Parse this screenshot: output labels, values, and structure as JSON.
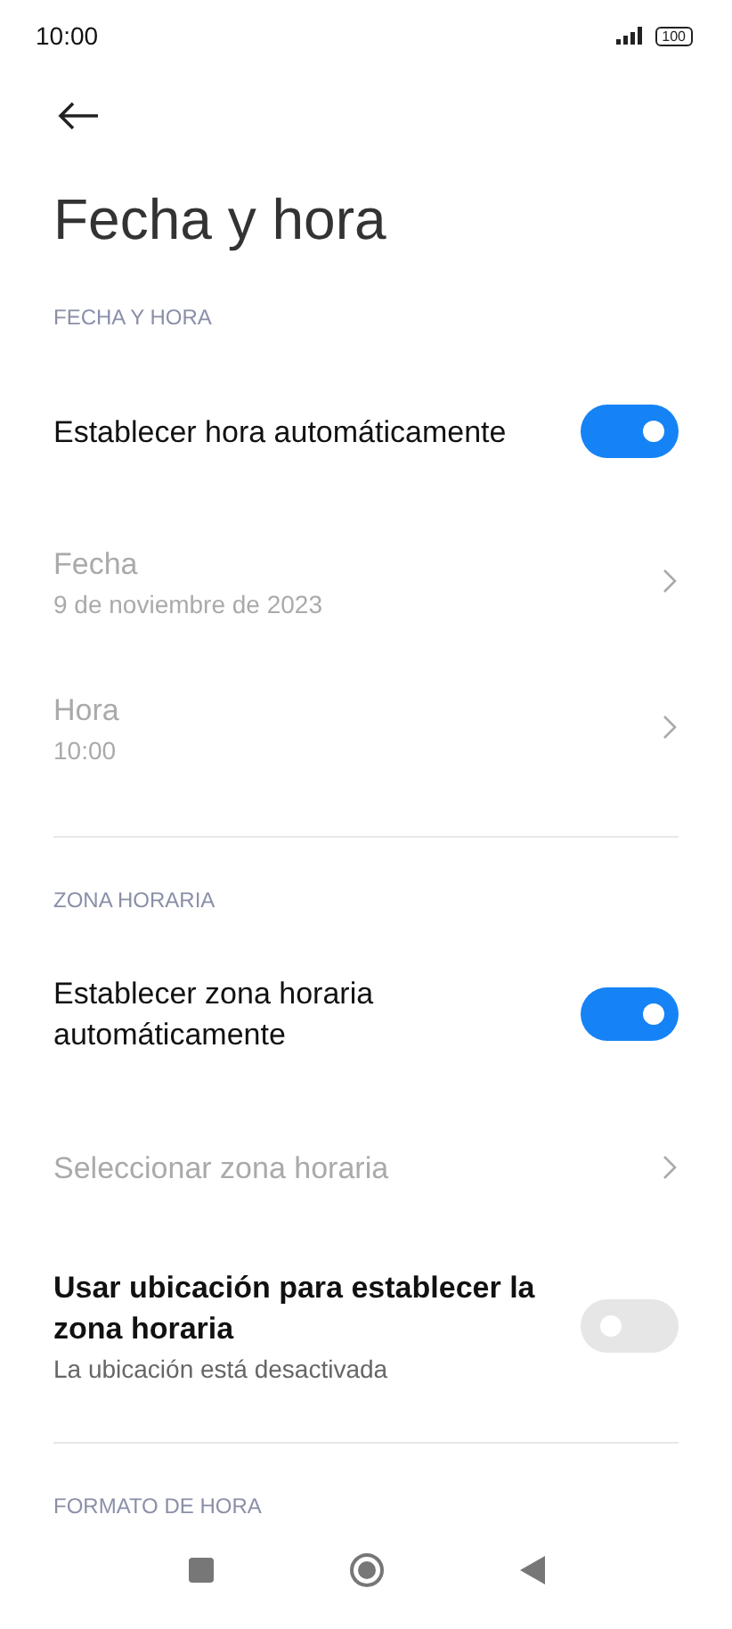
{
  "status_bar": {
    "time": "10:00",
    "battery": "100"
  },
  "title": "Fecha y hora",
  "sections": [
    {
      "kind": "header",
      "label": "FECHA Y HORA"
    },
    {
      "kind": "toggle",
      "title": "Establecer hora automáticamente",
      "on": true
    },
    {
      "kind": "link",
      "title": "Fecha",
      "subtitle": "9 de noviembre de 2023",
      "disabled": true
    },
    {
      "kind": "link",
      "title": "Hora",
      "subtitle": "10:00",
      "disabled": true
    },
    {
      "kind": "divider"
    },
    {
      "kind": "header",
      "label": "ZONA HORARIA"
    },
    {
      "kind": "toggle",
      "title": "Establecer zona horaria automáticamente",
      "on": true
    },
    {
      "kind": "link",
      "title": "Seleccionar zona horaria",
      "disabled": true
    },
    {
      "kind": "toggle",
      "title": "Usar ubicación para establecer la zona horaria",
      "subtitle": "La ubicación está desactivada",
      "on": false
    },
    {
      "kind": "divider"
    },
    {
      "kind": "header",
      "label": "FORMATO DE HORA"
    }
  ]
}
